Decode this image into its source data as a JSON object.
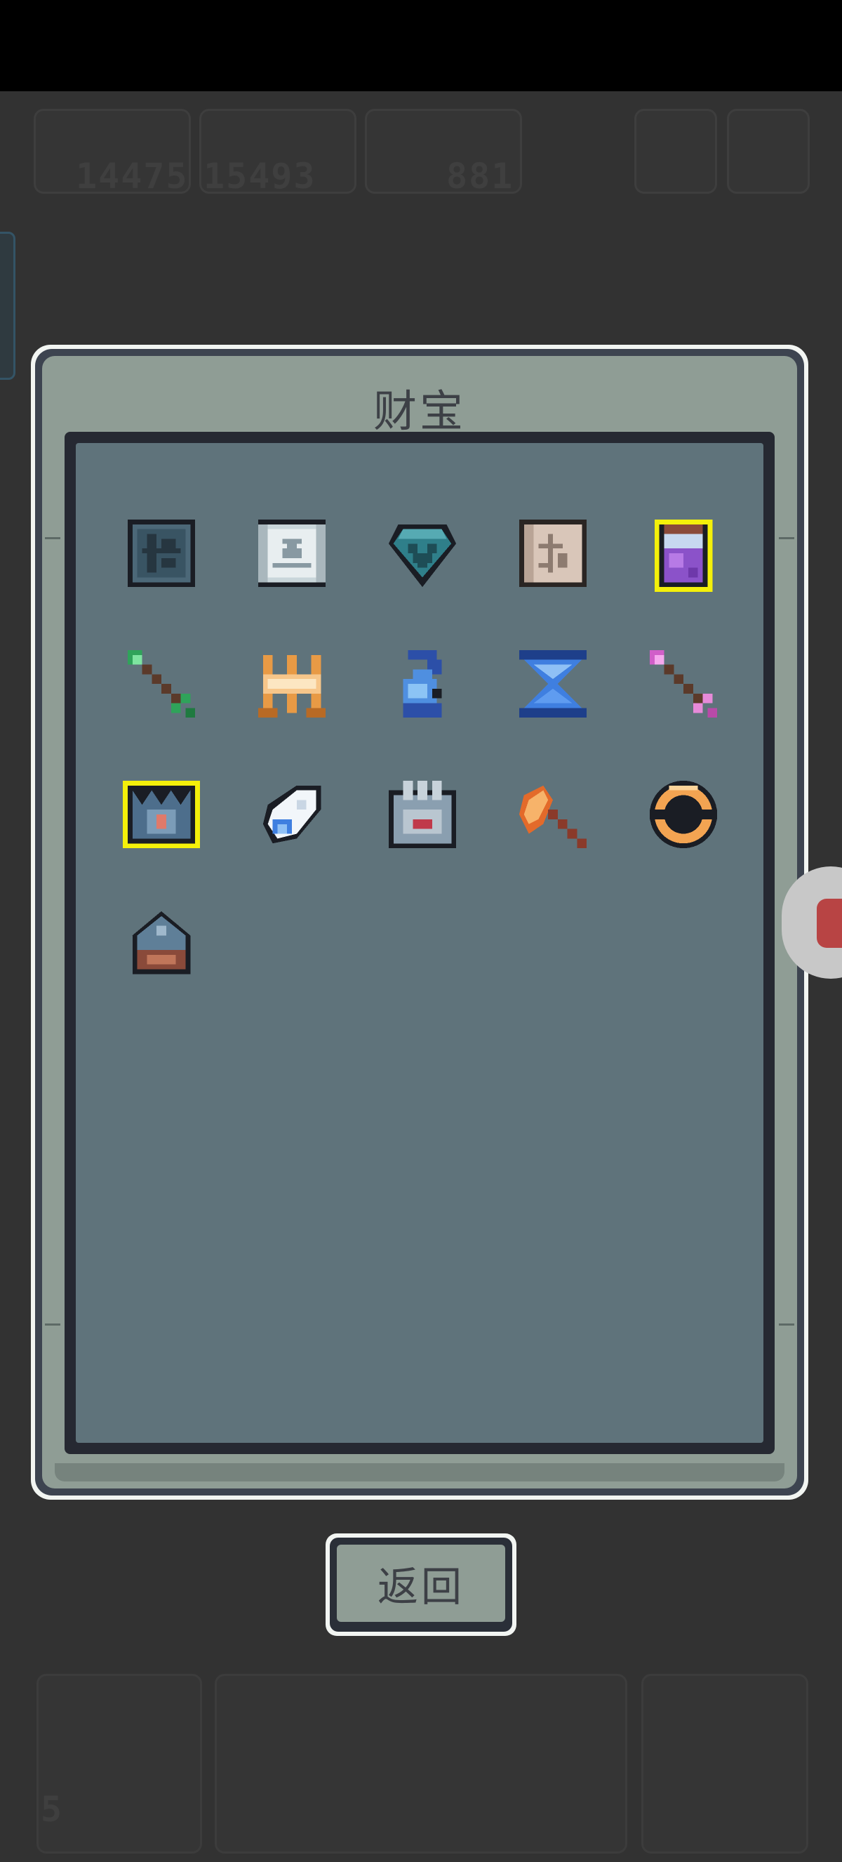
{
  "hud": {
    "currency_1": "14475",
    "currency_2": "15493",
    "currency_3": "881",
    "bottom_counter": "5"
  },
  "dialog": {
    "title": "财宝",
    "back_label": "返回"
  },
  "treasures": [
    {
      "icon": "dark-rune-tablet-icon",
      "highlighted": false
    },
    {
      "icon": "skull-scroll-icon",
      "highlighted": false
    },
    {
      "icon": "teal-heart-gem-icon",
      "highlighted": false
    },
    {
      "icon": "ancient-map-icon",
      "highlighted": false
    },
    {
      "icon": "purple-potion-jar-icon",
      "highlighted": true
    },
    {
      "icon": "green-arrow-icon",
      "highlighted": false
    },
    {
      "icon": "golden-claw-icon",
      "highlighted": false
    },
    {
      "icon": "blue-rabbit-icon",
      "highlighted": false
    },
    {
      "icon": "blue-hourglass-icon",
      "highlighted": false
    },
    {
      "icon": "pink-arrow-icon",
      "highlighted": false
    },
    {
      "icon": "spiked-crown-icon",
      "highlighted": true
    },
    {
      "icon": "feather-wing-icon",
      "highlighted": false
    },
    {
      "icon": "iron-gauntlet-icon",
      "highlighted": false
    },
    {
      "icon": "fire-axe-icon",
      "highlighted": false
    },
    {
      "icon": "orange-ring-icon",
      "highlighted": false
    },
    {
      "icon": "spiked-helmet-icon",
      "highlighted": false
    }
  ],
  "colors": {
    "highlight": "#f4f00a",
    "panel": "#8f9d95",
    "grid": "#5f737b"
  }
}
